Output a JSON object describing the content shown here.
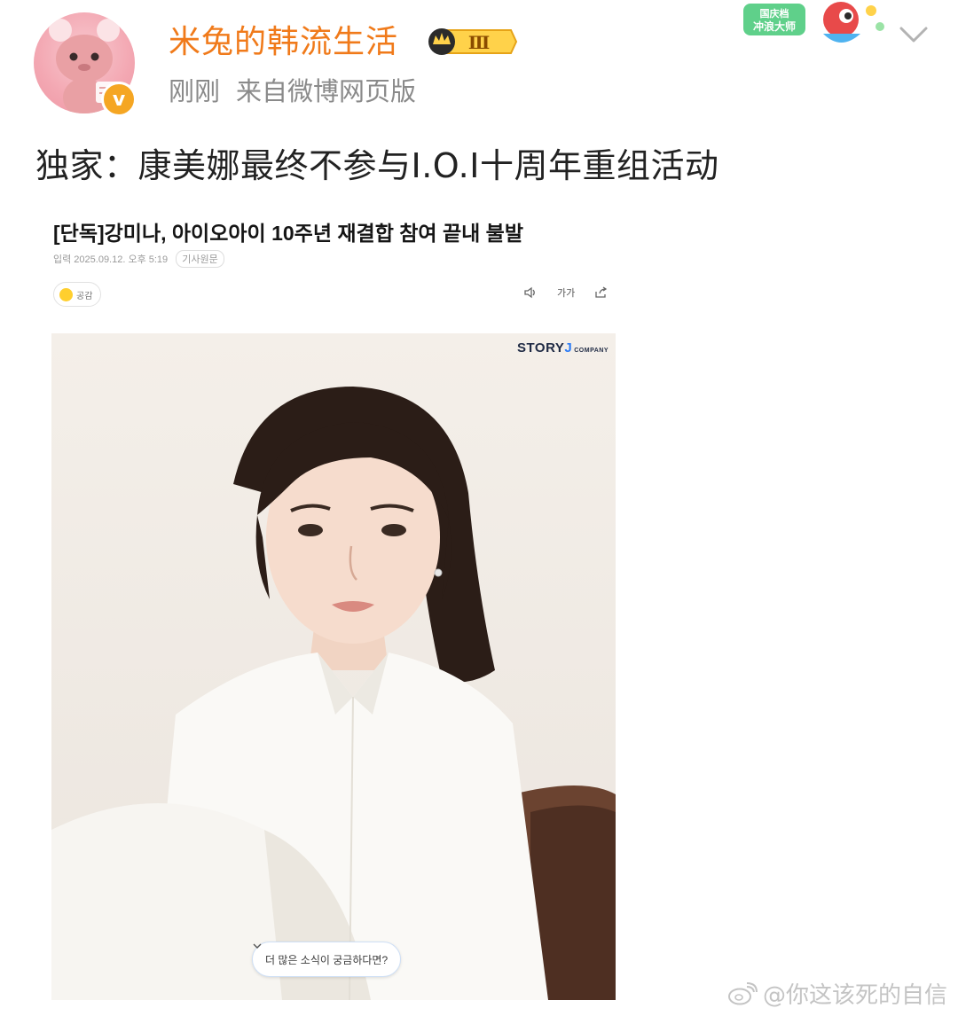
{
  "post": {
    "username": "米兔的韩流生活",
    "level_badge": "Ⅲ",
    "time": "刚刚",
    "source": "来自微博网页版",
    "verified_badge": "v",
    "text": "独家：康美娜最终不参与I.O.I十周年重组活动"
  },
  "sticker": {
    "line1": "国庆档",
    "line2": "冲浪大师"
  },
  "article": {
    "headline": "[단독]강미나, 아이오아이 10주년 재결합 참여 끝내 불발",
    "meta": "입력 2025.09.12. 오후 5:19",
    "original_label": "기사원문",
    "like_label": "공감",
    "font_tool": "가가",
    "photo_brand_main": "STORY",
    "photo_brand_j": "J",
    "photo_brand_sub": "COMPANY",
    "more_button": "더 많은 소식이 궁금하다면?"
  },
  "watermark": {
    "text": "@你这该死的自信"
  },
  "icons": {
    "menu": "chevron-down-icon",
    "speaker": "speaker-icon",
    "share": "share-icon",
    "weibo": "weibo-logo-icon"
  },
  "colors": {
    "username": "#f07a1a",
    "meta": "#8a8a8a",
    "verified": "#f5a623",
    "accent_blue": "#2c7cf6"
  }
}
